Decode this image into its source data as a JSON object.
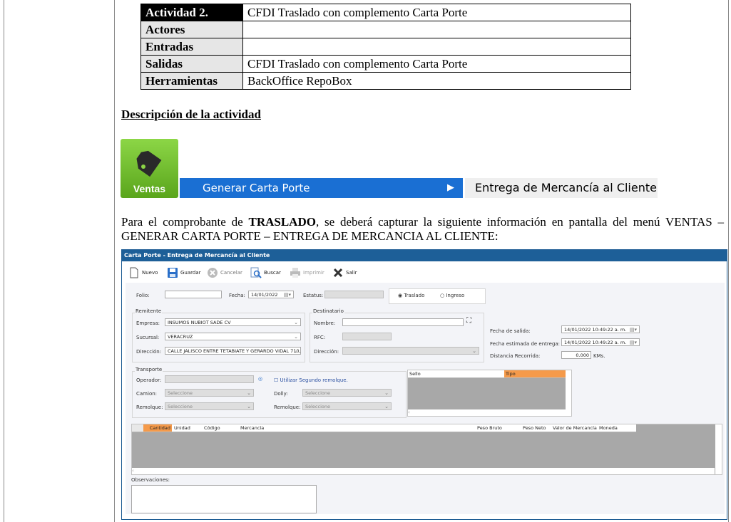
{
  "activity_table": [
    {
      "key": "Actividad 2.",
      "value": "CFDI Traslado con complemento Carta Porte"
    },
    {
      "key": "Actores",
      "value": ""
    },
    {
      "key": "Entradas",
      "value": ""
    },
    {
      "key": "Salidas",
      "value": "CFDI Traslado con complemento Carta Porte"
    },
    {
      "key": "Herramientas",
      "value": "BackOffice RepoBox"
    }
  ],
  "heading": "Descripción de la actividad",
  "menu": {
    "tile_label": "Ventas",
    "item": "Generar Carta Porte",
    "submenu": "Entrega de Mercancía al Cliente"
  },
  "paragraph": {
    "before": "Para el comprobante de ",
    "bold": "TRASLADO",
    "after": ", se deberá capturar la siguiente información en pantalla del menú VENTAS – GENERAR CARTA PORTE – ENTREGA DE MERCANCIA AL CLIENTE:"
  },
  "app": {
    "title": "Carta Porte - Entrega de Mercancía al Cliente",
    "toolbar": {
      "nuevo": "Nuevo",
      "guardar": "Guardar",
      "cancelar": "Cancelar",
      "buscar": "Buscar",
      "imprimir": "Imprimir",
      "salir": "Salir"
    },
    "folio_label": "Folio:",
    "fecha_label": "Fecha:",
    "fecha_value": "14/01/2022",
    "estatus_label": "Estatus:",
    "traslado": "Traslado",
    "ingreso": "Ingreso",
    "remitente": "Remitente",
    "empresa_label": "Empresa:",
    "empresa_value": "INSUMOS NUBIOT SADE CV",
    "sucursal_label": "Sucursal:",
    "sucursal_value": "VERACRUZ",
    "direccion_label": "Dirección:",
    "direccion_value": "CALLE JALISCO ENTRE TETABIATE Y GERARDO VIDAL 710, ...",
    "destinatario": "Destinatario",
    "nombre_label": "Nombre:",
    "rfc_label": "RFC:",
    "dest_direccion_label": "Dirección:",
    "fecha_salida_label": "Fecha de salida:",
    "fecha_salida_value": "14/01/2022 10:49:22 a. m.",
    "fecha_entrega_label": "Fecha estimada de entrega:",
    "fecha_entrega_value": "14/01/2022 10:49:22 a. m.",
    "distancia_label": "Distancia Recorrida:",
    "distancia_value": "0.000",
    "distancia_unit": "KMs.",
    "transporte": "Transporte",
    "operador_label": "Operador:",
    "segundo_remolque": "Utilizar Segundo remolque.",
    "camion_label": "Camion:",
    "dolly_label": "Dolly:",
    "remolque_label": "Remolque:",
    "remolque2_label": "Remolque:",
    "seleccione": "Seleccione",
    "sello_col": "Sello",
    "tipo_col": "Tipo",
    "grid_cols": [
      "Cantidad",
      "Unidad",
      "Código",
      "Mercancía",
      "Peso Bruto",
      "Peso Neto",
      "Valor de Mercancía",
      "Moneda"
    ],
    "observaciones_label": "Observaciones:"
  }
}
